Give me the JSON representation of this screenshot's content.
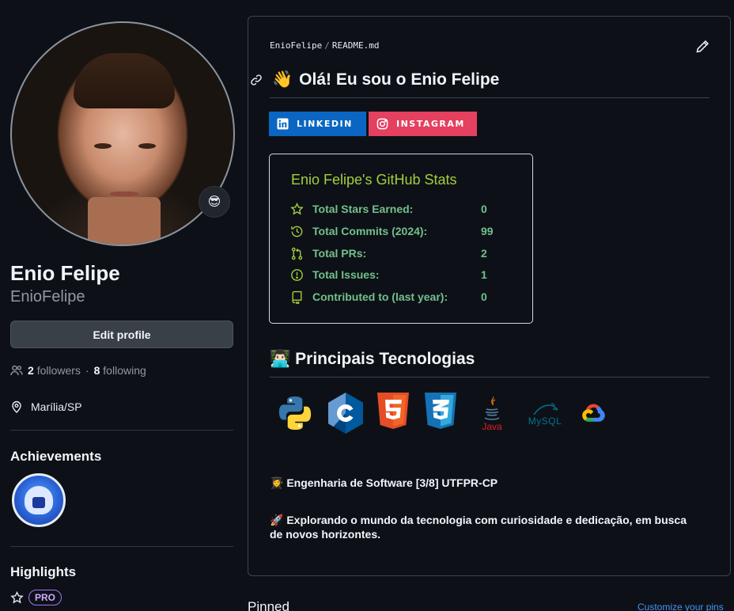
{
  "profile": {
    "avatar_emoji": "😎",
    "name": "Enio Felipe",
    "login": "EnioFelipe",
    "edit_profile": "Edit profile",
    "followers_count": "2",
    "followers_label": "followers",
    "separator": "·",
    "following_count": "8",
    "following_label": "following",
    "location": "Marília/SP",
    "achievements_title": "Achievements",
    "highlights_title": "Highlights",
    "pro_label": "PRO"
  },
  "readme": {
    "owner": "EnioFelipe",
    "file": "README.md",
    "heading_emoji": "👋",
    "heading": "Olá! Eu sou o Enio Felipe",
    "badges": [
      {
        "label": "LINKEDIN",
        "color": "#0a66c2"
      },
      {
        "label": "INSTAGRAM",
        "color": "#e4405f"
      }
    ],
    "stats": {
      "title": "Enio Felipe's GitHub Stats",
      "rows": [
        {
          "label": "Total Stars Earned:",
          "value": "0",
          "icon": "star-icon"
        },
        {
          "label": "Total Commits (2024):",
          "value": "99",
          "icon": "history-icon"
        },
        {
          "label": "Total PRs:",
          "value": "2",
          "icon": "pull-request-icon"
        },
        {
          "label": "Total Issues:",
          "value": "1",
          "icon": "issue-icon"
        },
        {
          "label": "Contributed to (last year):",
          "value": "0",
          "icon": "repo-icon"
        }
      ]
    },
    "tech_heading_emoji": "👨🏻‍💻",
    "tech_heading": "Principais Tecnologias",
    "tech_icons": [
      "python-icon",
      "c-icon",
      "html5-icon",
      "css3-icon",
      "java-icon",
      "mysql-icon",
      "google-cloud-icon"
    ],
    "java_label": "Java",
    "mysql_label": "MySQL",
    "para1_emoji": "👩‍🎓",
    "para1": "Engenharia de Software [3/8] UTFPR-CP",
    "para2_emoji": "🚀",
    "para2_line1": "Explorando o mundo da tecnologia com curiosidade e dedicação, em busca",
    "para2_line2": "de novos horizontes."
  },
  "pinned": {
    "title": "Pinned",
    "customize": "Customize your pins"
  },
  "colors": {
    "background": "#0d1117",
    "stats_title": "#a5cd3c",
    "stats_text": "#73c08b",
    "link": "#4493f8",
    "pro": "#a371f7"
  }
}
